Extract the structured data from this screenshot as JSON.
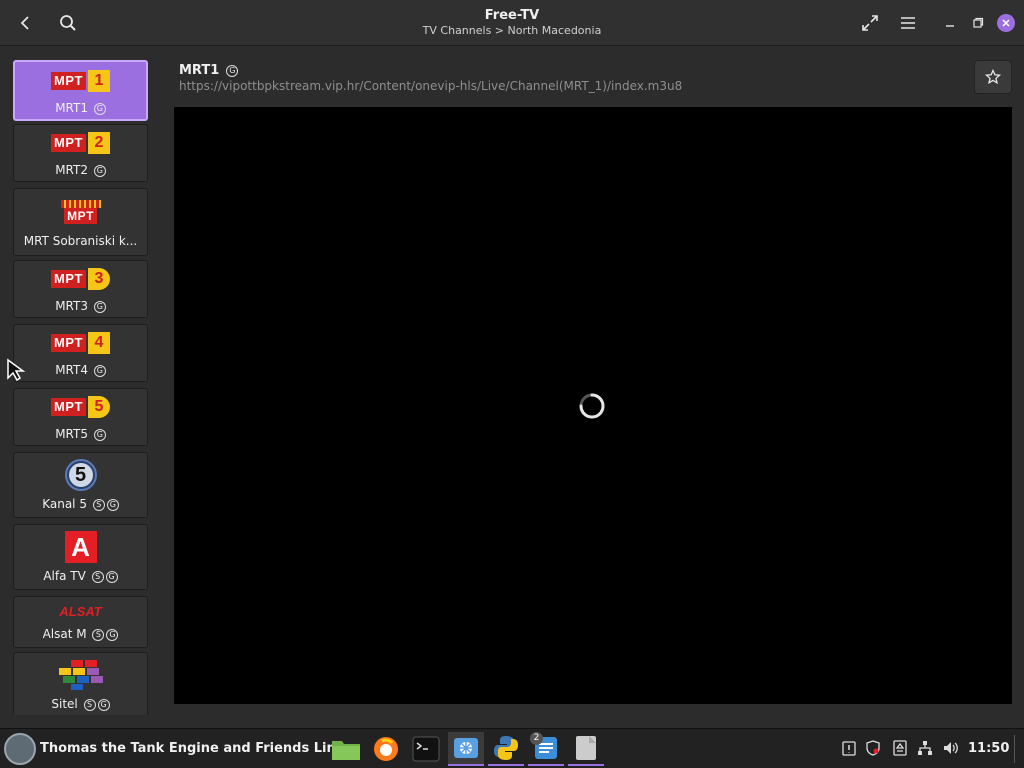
{
  "window": {
    "title": "Free-TV",
    "subtitle": "TV Channels > North Macedonia"
  },
  "channels": [
    {
      "label": "MRT1",
      "badges": [
        "G"
      ],
      "logo_text": "MPT",
      "logo_number": "1",
      "selected": true
    },
    {
      "label": "MRT2",
      "badges": [
        "G"
      ],
      "logo_text": "MPT",
      "logo_number": "2",
      "selected": false
    },
    {
      "label": "MRT Sobraniski k...",
      "badges": [],
      "logo_text": "MPT",
      "logo_number": "",
      "selected": false
    },
    {
      "label": "MRT3",
      "badges": [
        "G"
      ],
      "logo_text": "MPT",
      "logo_number": "3",
      "selected": false
    },
    {
      "label": "MRT4",
      "badges": [
        "G"
      ],
      "logo_text": "MPT",
      "logo_number": "4",
      "selected": false
    },
    {
      "label": "MRT5",
      "badges": [
        "G"
      ],
      "logo_text": "MPT",
      "logo_number": "5",
      "selected": false
    },
    {
      "label": "Kanal 5",
      "badges": [
        "S",
        "G"
      ],
      "logo_text": "5",
      "logo_number": "",
      "selected": false
    },
    {
      "label": "Alfa TV",
      "badges": [
        "S",
        "G"
      ],
      "logo_text": "A",
      "logo_number": "",
      "selected": false
    },
    {
      "label": "Alsat M",
      "badges": [
        "S",
        "G"
      ],
      "logo_text": "ALSAT",
      "logo_number": "",
      "selected": false
    },
    {
      "label": "Sitel",
      "badges": [
        "S",
        "G"
      ],
      "logo_text": "",
      "logo_number": "",
      "selected": false
    }
  ],
  "current": {
    "name": "MRT1",
    "badge": "G",
    "url": "https://vipottbpkstream.vip.hr/Content/onevip-hls/Live/Channel(MRT_1)/index.m3u8"
  },
  "taskbar": {
    "window_label": "Thomas the Tank Engine and Friends Linux",
    "clock": "11:50",
    "notes_badge": "2"
  },
  "colors": {
    "accent": "#9b6fe0",
    "mrt_red": "#d0201f",
    "mrt_yellow": "#f5c518"
  }
}
